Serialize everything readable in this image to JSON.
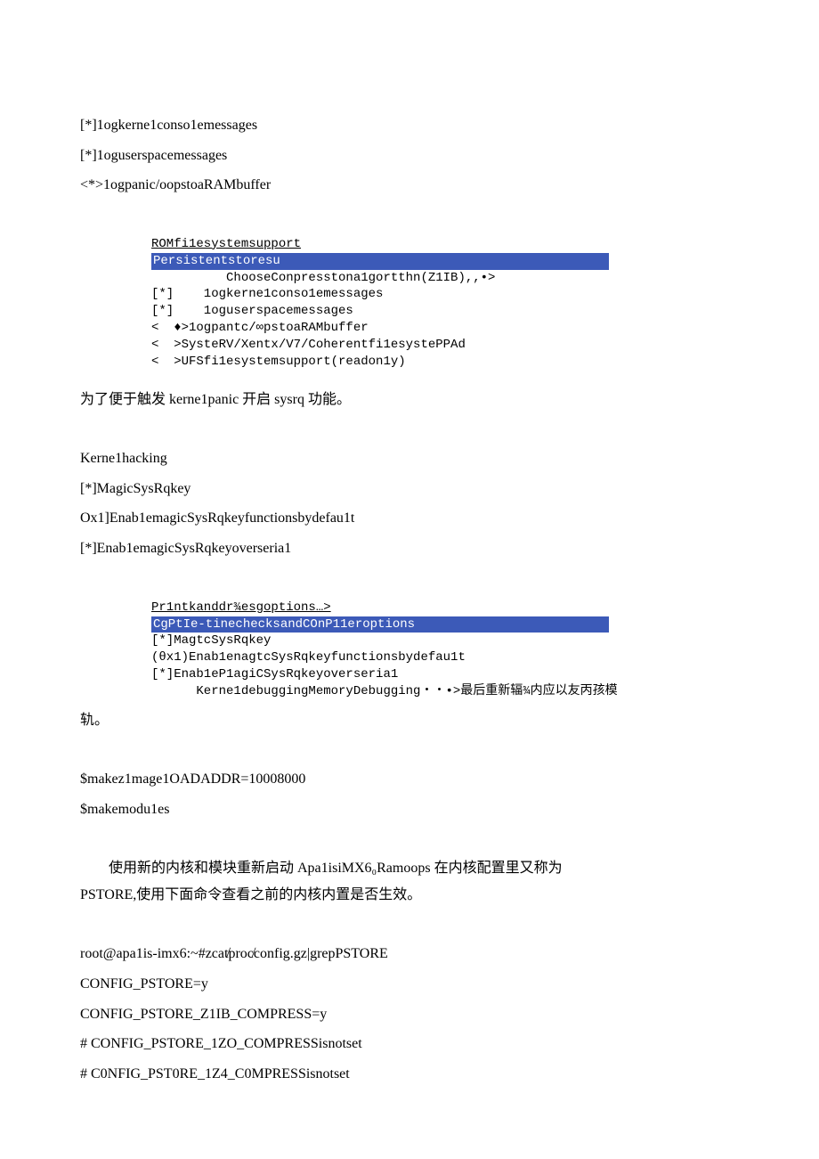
{
  "cfg1": {
    "l1": "[*]1ogkerne1conso1emessages",
    "l2": "[*]1oguserspacemessages",
    "l3": "<*>1ogpanic/oopstoaRAMbuffer"
  },
  "mono1": {
    "u1": "ROMfi1esystemsupport",
    "h1": "Persistentstoresu",
    "l1": "          ChooseConpresstona1gortthn(Z1IB),,•>",
    "l2": "[*]    1ogkerne1conso1emessages",
    "l3": "[*]    1oguserspacemessages",
    "l4": "<  ♦>1ogpantc/∞pstoaRAMbuffer",
    "l5": "<  >SysteRV/Xentx/V7/Coherentfi1esystePPAd",
    "l6": "<  >UFSfi1esystemsupport(readon1y)"
  },
  "p1": "为了便于触发 kerne1panic 开启 sysrq 功能。",
  "cfg2": {
    "l1": "Kerne1hacking",
    "l2": "[*]MagicSysRqkey",
    "l3": "Ox1]Enab1emagicSysRqkeyfunctionsbydefau1t",
    "l4": "[*]Enab1emagicSysRqkeyoverseria1"
  },
  "mono2": {
    "u1": "Pr1ntkanddr¾esgoptions…>",
    "h1": "CgPtIe-tinechecksandCOnP11eroptions",
    "l1": "[*]MagtcSysRqkey",
    "l2": "(θx1)Enab1enagtcSysRqkeyfunctionsbydefau1t",
    "l3": "[*]Enab1eP1agiCSysRqkeyoverseria1",
    "l4": "      Kerne1debuggingMemoryDebugging・・•>最后重新辐¾内应以友丙孩模"
  },
  "p2tail": "轨。",
  "cfg3": {
    "l1": "$makez1mage1OADADDR=10008000",
    "l2": "$makemodu1es"
  },
  "p3": "使用新的内核和模块重新启动 Apa1isiMX6₀Ramoops 在内核配置里又称为",
  "p3b": "PSTORE,使用下面命令查看之前的内核内置是否生效。",
  "cfg4": {
    "l1": "root@apa1is-imx6:~#zcat̸proc̸config.gz|grepPSTORE",
    "l2": "CONFIG_PSTORE=y",
    "l3": "CONFIG_PSTORE_Z1IB_COMPRESS=y",
    "l4": "#   CONFIG_PSTORE_1ZO_COMPRESSisnotset",
    "l5": "#   C0NFIG_PST0RE_1Z4_C0MPRESSisnotset"
  }
}
